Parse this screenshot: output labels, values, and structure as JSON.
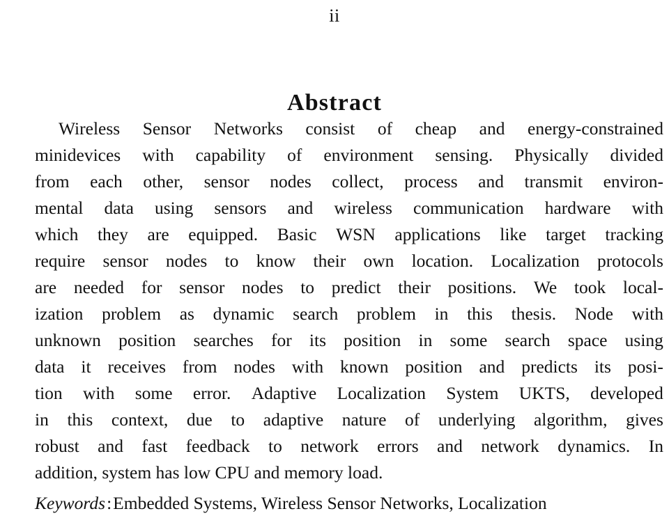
{
  "page": {
    "folio": "ii",
    "heading": "Abstract"
  },
  "abstract": {
    "lines": [
      {
        "indent": true,
        "justified": true,
        "words": [
          "Wireless",
          "Sensor",
          "Networks",
          "consist",
          "of",
          "cheap",
          "and",
          "energy-constrained"
        ]
      },
      {
        "indent": false,
        "justified": true,
        "words": [
          "minidevices",
          "with",
          "capability",
          "of",
          "environment",
          "sensing.",
          "Physically",
          "divided"
        ]
      },
      {
        "indent": false,
        "justified": true,
        "words": [
          "from",
          "each",
          "other,",
          "sensor",
          "nodes",
          "collect,",
          "process",
          "and",
          "transmit",
          "environ-"
        ]
      },
      {
        "indent": false,
        "justified": true,
        "words": [
          "mental",
          "data",
          "using",
          "sensors",
          "and",
          "wireless",
          "communication",
          "hardware",
          "with"
        ]
      },
      {
        "indent": false,
        "justified": true,
        "words": [
          "which",
          "they",
          "are",
          "equipped.",
          "Basic",
          "WSN",
          "applications",
          "like",
          "target",
          "tracking"
        ]
      },
      {
        "indent": false,
        "justified": true,
        "words": [
          "require",
          "sensor",
          "nodes",
          "to",
          "know",
          "their",
          "own",
          "location.",
          "Localization",
          "protocols"
        ]
      },
      {
        "indent": false,
        "justified": true,
        "words": [
          "are",
          "needed",
          "for",
          "sensor",
          "nodes",
          "to",
          "predict",
          "their",
          "positions.",
          "We",
          "took",
          "local-"
        ]
      },
      {
        "indent": false,
        "justified": true,
        "words": [
          "ization",
          "problem",
          "as",
          "dynamic",
          "search",
          "problem",
          "in",
          "this",
          "thesis.",
          "Node",
          "with"
        ]
      },
      {
        "indent": false,
        "justified": true,
        "words": [
          "unknown",
          "position",
          "searches",
          "for",
          "its",
          "position",
          "in",
          "some",
          "search",
          "space",
          "using"
        ]
      },
      {
        "indent": false,
        "justified": true,
        "words": [
          "data",
          "it",
          "receives",
          "from",
          "nodes",
          "with",
          "known",
          "position",
          "and",
          "predicts",
          "its",
          "posi-"
        ]
      },
      {
        "indent": false,
        "justified": true,
        "words": [
          "tion",
          "with",
          "some",
          "error.",
          "Adaptive",
          "Localization",
          "System",
          "UKTS,",
          "developed"
        ]
      },
      {
        "indent": false,
        "justified": true,
        "words": [
          "in",
          "this",
          "context,",
          "due",
          "to",
          "adaptive",
          "nature",
          "of",
          "underlying",
          "algorithm,",
          "gives"
        ]
      },
      {
        "indent": false,
        "justified": true,
        "words": [
          "robust",
          "and",
          "fast",
          "feedback",
          "to",
          "network",
          "errors",
          "and",
          "network",
          "dynamics.",
          "In"
        ]
      },
      {
        "indent": false,
        "justified": false,
        "text": "addition, system has low CPU and memory load."
      }
    ]
  },
  "keywords": {
    "label": "Keywords",
    "separator": ":",
    "value": "Embedded Systems, Wireless Sensor Networks, Localization"
  }
}
